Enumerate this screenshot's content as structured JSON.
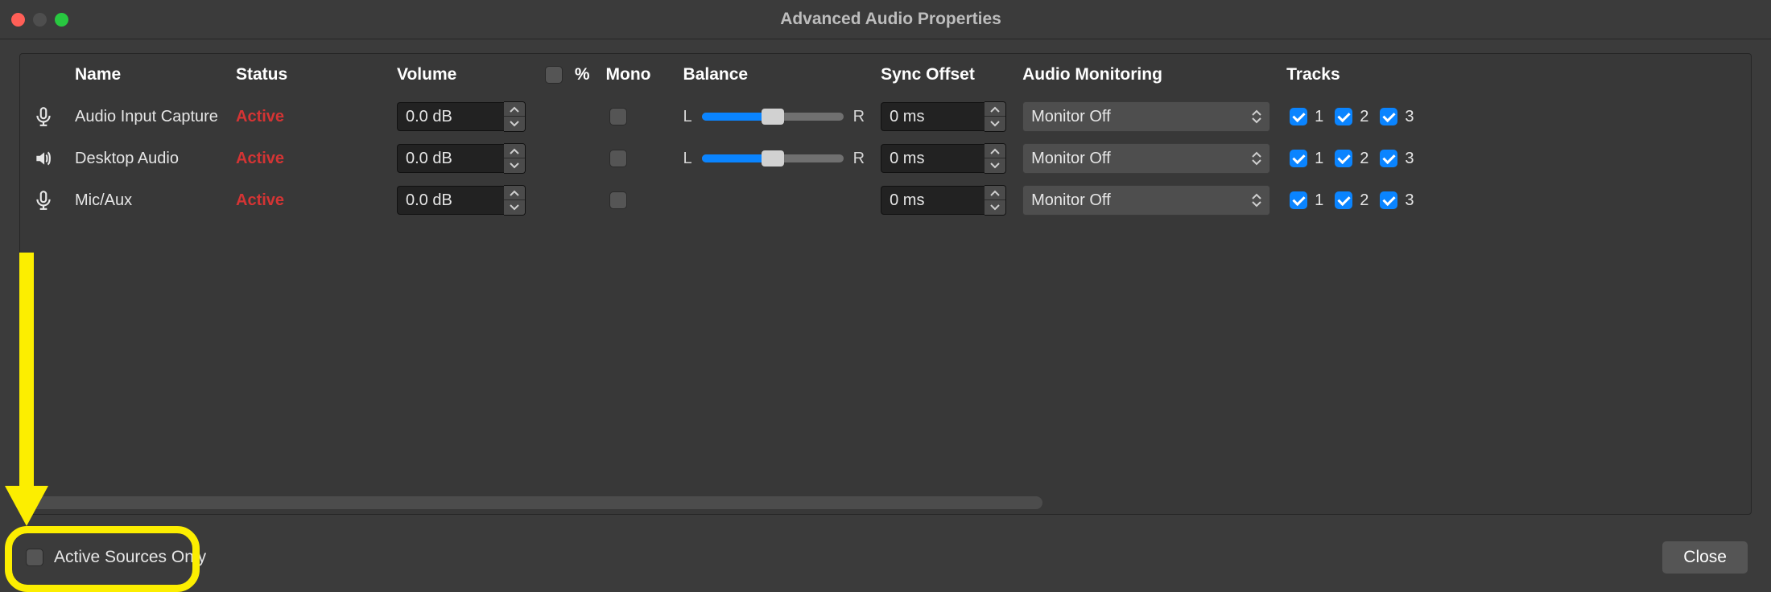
{
  "title": "Advanced Audio Properties",
  "headers": {
    "name": "Name",
    "status": "Status",
    "volume": "Volume",
    "percent": "%",
    "mono": "Mono",
    "balance": "Balance",
    "sync": "Sync Offset",
    "monitor": "Audio Monitoring",
    "tracks": "Tracks"
  },
  "balance_labels": {
    "left": "L",
    "right": "R"
  },
  "rows": [
    {
      "icon": "mic",
      "name": "Audio Input Capture",
      "status": "Active",
      "volume": "0.0 dB",
      "mono": false,
      "show_balance": true,
      "balance_pct": 50,
      "sync": "0 ms",
      "monitor": "Monitor Off",
      "tracks": [
        {
          "n": "1",
          "checked": true
        },
        {
          "n": "2",
          "checked": true
        },
        {
          "n": "3",
          "checked": true
        }
      ]
    },
    {
      "icon": "speaker",
      "name": "Desktop Audio",
      "status": "Active",
      "volume": "0.0 dB",
      "mono": false,
      "show_balance": true,
      "balance_pct": 50,
      "sync": "0 ms",
      "monitor": "Monitor Off",
      "tracks": [
        {
          "n": "1",
          "checked": true
        },
        {
          "n": "2",
          "checked": true
        },
        {
          "n": "3",
          "checked": true
        }
      ]
    },
    {
      "icon": "mic",
      "name": "Mic/Aux",
      "status": "Active",
      "volume": "0.0 dB",
      "mono": false,
      "show_balance": false,
      "balance_pct": 50,
      "sync": "0 ms",
      "monitor": "Monitor Off",
      "tracks": [
        {
          "n": "1",
          "checked": true
        },
        {
          "n": "2",
          "checked": true
        },
        {
          "n": "3",
          "checked": true
        }
      ]
    }
  ],
  "percent_checked": false,
  "footer": {
    "active_sources_label": "Active Sources Only",
    "active_sources_checked": false,
    "close": "Close"
  }
}
